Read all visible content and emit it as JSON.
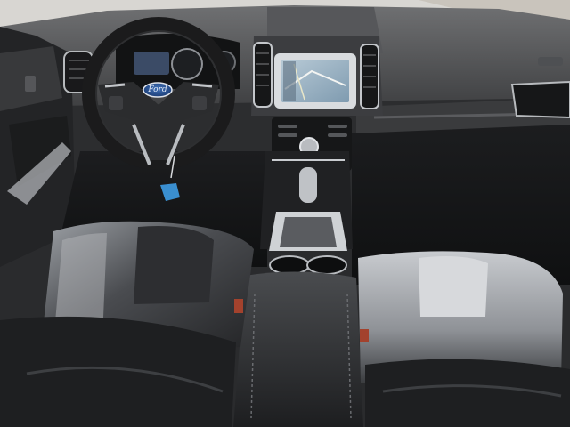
{
  "image": {
    "scene": "car-interior-dashboard",
    "vehicle_brand_logo": "Ford",
    "colors": {
      "dashboard": "#3a3b3d",
      "dashboard_top": "#5d5e60",
      "seat_leather": "#2b2c2e",
      "seat_highlight": "#b9bcc0",
      "chrome": "#c9ccd0",
      "screen": "#9fb7c8",
      "keychain_tag": "#3a8fd0"
    },
    "screen_state": "navigation-map",
    "gear_selector": "automatic-shifter"
  }
}
